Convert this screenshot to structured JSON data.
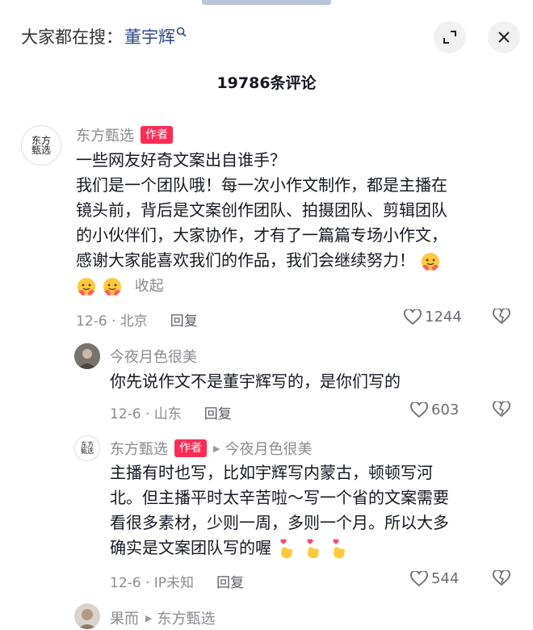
{
  "header": {
    "search_prefix": "大家都在搜：",
    "search_keyword": "董宇辉",
    "search_icon": "search-icon",
    "expand_icon": "expand-icon",
    "close_icon": "close-icon"
  },
  "comment_count_title": "19786条评论",
  "comments": [
    {
      "avatar_text": "东方甄选",
      "username": "东方甄选",
      "author_tag": "作者",
      "lines": [
        "一些网友好奇文案出自谁手？",
        "我们是一个团队哦！每一次小作文制作，都是主播在",
        "镜头前，背后是文案创作团队、拍摄团队、剪辑团队",
        "的小伙伴们，大家协作，才有了一篇篇专场小作文，",
        "感谢大家能喜欢我们的作品，我们会继续努力！"
      ],
      "collapse_label": "收起",
      "date_location": "12-6 · 北京",
      "reply_label": "回复",
      "likes": "1244"
    },
    {
      "username": "今夜月色很美",
      "lines": [
        "你先说作文不是董宇辉写的，是你们写的"
      ],
      "date_location": "12-6 · 山东",
      "reply_label": "回复",
      "likes": "603"
    },
    {
      "avatar_text": "东方甄选",
      "username": "东方甄选",
      "author_tag": "作者",
      "reply_to": "今夜月色很美",
      "lines": [
        "主播有时也写，比如宇辉写内蒙古，顿顿写河",
        "北。但主播平时太辛苦啦～写一个省的文案需要",
        "看很多素材，少则一周，多则一个月。所以大多",
        "确实是文案团队写的喔"
      ],
      "date_location": "12-6 · IP未知",
      "reply_label": "回复",
      "likes": "544"
    },
    {
      "username": "果而",
      "reply_to": "东方甄选"
    }
  ]
}
